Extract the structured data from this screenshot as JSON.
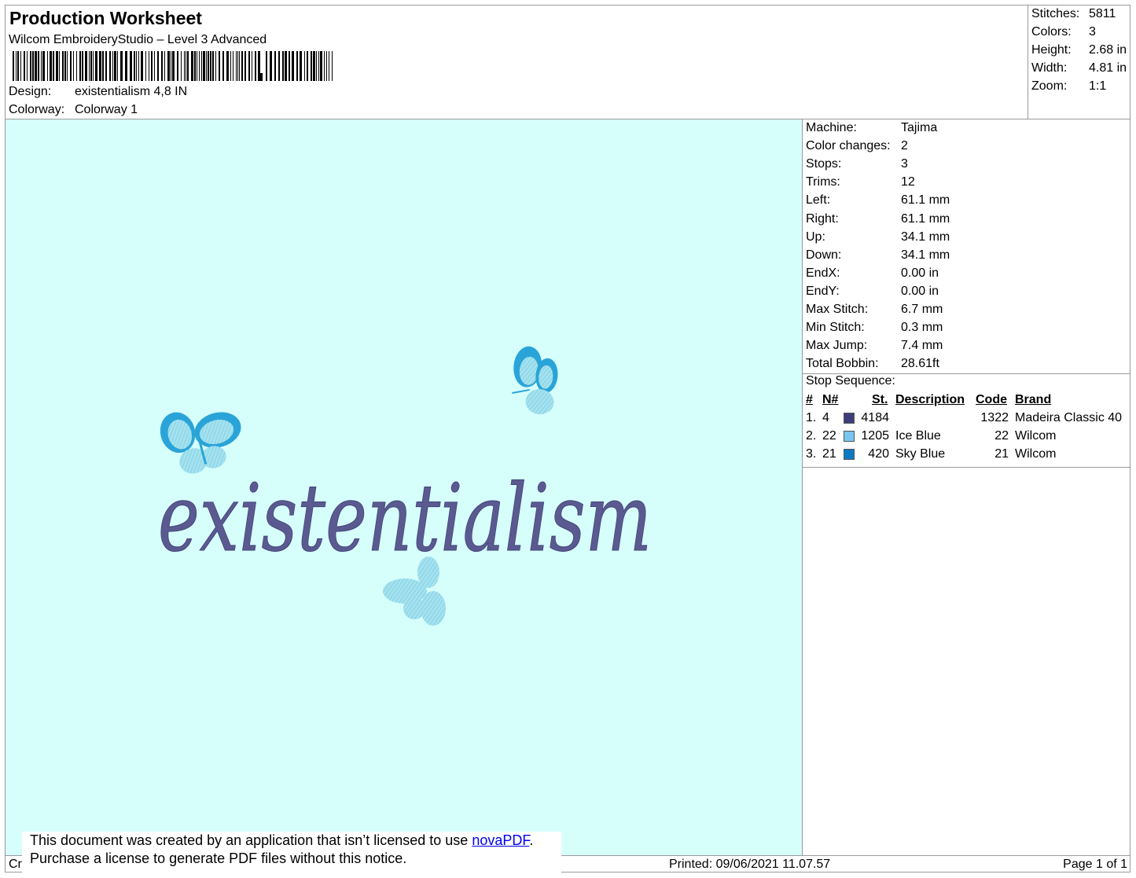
{
  "header": {
    "title": "Production Worksheet",
    "subtitle": "Wilcom EmbroideryStudio – Level 3 Advanced",
    "design_label": "Design:",
    "design_value": "existentialism 4,8 IN",
    "colorway_label": "Colorway:",
    "colorway_value": "Colorway 1"
  },
  "stats": [
    {
      "label": "Stitches:",
      "value": "5811"
    },
    {
      "label": "Colors:",
      "value": "3"
    },
    {
      "label": "Height:",
      "value": "2.68 in"
    },
    {
      "label": "Width:",
      "value": "4.81 in"
    },
    {
      "label": "Zoom:",
      "value": "1:1"
    }
  ],
  "machine_info": [
    {
      "label": "Machine:",
      "value": "Tajima"
    },
    {
      "label": "Color changes:",
      "value": "2"
    },
    {
      "label": "Stops:",
      "value": "3"
    },
    {
      "label": "Trims:",
      "value": "12"
    },
    {
      "label": "Left:",
      "value": "61.1 mm"
    },
    {
      "label": "Right:",
      "value": "61.1 mm"
    },
    {
      "label": "Up:",
      "value": "34.1 mm"
    },
    {
      "label": "Down:",
      "value": "34.1 mm"
    },
    {
      "label": "EndX:",
      "value": "0.00 in"
    },
    {
      "label": "EndY:",
      "value": "0.00 in"
    },
    {
      "label": "Max Stitch:",
      "value": "6.7 mm"
    },
    {
      "label": "Min Stitch:",
      "value": "0.3 mm"
    },
    {
      "label": "Max Jump:",
      "value": "7.4 mm"
    },
    {
      "label": "Total Bobbin:",
      "value": "28.61ft"
    }
  ],
  "stop_sequence": {
    "title": "Stop Sequence:",
    "headers": {
      "num": "#",
      "n": "N#",
      "st": "St.",
      "desc": "Description",
      "code": "Code",
      "brand": "Brand"
    },
    "rows": [
      {
        "num": "1.",
        "n": "4",
        "color": "#3d3c7c",
        "st": "4184",
        "desc": "",
        "code": "1322",
        "brand": "Madeira Classic 40"
      },
      {
        "num": "2.",
        "n": "22",
        "color": "#79c6f0",
        "st": "1205",
        "desc": "Ice Blue",
        "code": "22",
        "brand": "Wilcom"
      },
      {
        "num": "3.",
        "n": "21",
        "color": "#0d7bc4",
        "st": "420",
        "desc": "Sky Blue",
        "code": "21",
        "brand": "Wilcom"
      }
    ]
  },
  "design_preview": {
    "text": "existentialism",
    "background": "#d6fffc",
    "thread_colors": [
      "#5a5a90",
      "#9fe0ec",
      "#2aa4d8"
    ]
  },
  "footer": {
    "left_fragment": "Cr",
    "printed": "Printed: 09/06/2021 11.07.57",
    "page": "Page 1 of 1"
  },
  "notice": {
    "line1_prefix": "This document was created by an application that isn’t licensed to use ",
    "link": "novaPDF",
    "line1_suffix": ".",
    "line2": "Purchase a license to generate PDF files without this notice."
  }
}
